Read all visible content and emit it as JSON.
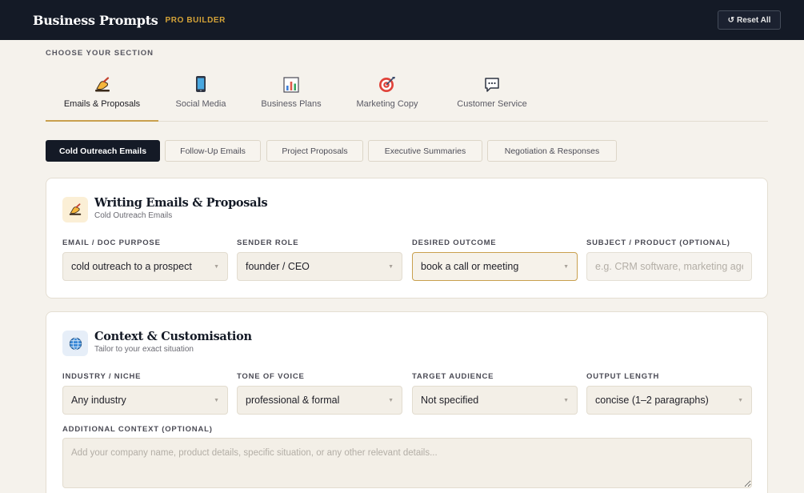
{
  "header": {
    "brand": "Business Prompts",
    "badge": "PRO BUILDER",
    "reset_label": "Reset All"
  },
  "section_label": "CHOOSE YOUR SECTION",
  "categories": [
    {
      "label": "Emails & Proposals",
      "icon": "writing-hand-icon",
      "active": true
    },
    {
      "label": "Social Media",
      "icon": "mobile-phone-icon"
    },
    {
      "label": "Business Plans",
      "icon": "bar-chart-icon"
    },
    {
      "label": "Marketing Copy",
      "icon": "target-icon"
    },
    {
      "label": "Customer Service",
      "icon": "speech-bubble-icon"
    }
  ],
  "subtabs": [
    {
      "label": "Cold Outreach Emails",
      "active": true
    },
    {
      "label": "Follow-Up Emails"
    },
    {
      "label": "Project Proposals"
    },
    {
      "label": "Executive Summaries"
    },
    {
      "label": "Negotiation & Responses"
    }
  ],
  "card1": {
    "title": "Writing Emails & Proposals",
    "subtitle": "Cold Outreach Emails",
    "icon": "writing-hand-icon",
    "fields": [
      {
        "label": "EMAIL / DOC PURPOSE",
        "value": "cold outreach to a prospect"
      },
      {
        "label": "SENDER ROLE",
        "value": "founder / CEO"
      },
      {
        "label": "DESIRED OUTCOME",
        "value": "book a call or meeting"
      },
      {
        "label": "SUBJECT / PRODUCT (OPTIONAL)",
        "placeholder": "e.g. CRM software, marketing agency"
      }
    ]
  },
  "card2": {
    "title": "Context & Customisation",
    "subtitle": "Tailor to your exact situation",
    "icon": "globe-icon",
    "fields": [
      {
        "label": "INDUSTRY / NICHE",
        "value": "Any industry"
      },
      {
        "label": "TONE OF VOICE",
        "value": "professional & formal"
      },
      {
        "label": "TARGET AUDIENCE",
        "value": "Not specified"
      },
      {
        "label": "OUTPUT LENGTH",
        "value": "concise (1–2 paragraphs)"
      }
    ],
    "additional_label": "ADDITIONAL CONTEXT (OPTIONAL)",
    "additional_placeholder": "Add your company name, product details, specific situation, or any other relevant details..."
  },
  "colors": {
    "navy": "#141a26",
    "gold": "#c9a04e",
    "badge_gold": "#d4a338",
    "page_bg": "#f5f2ec"
  }
}
